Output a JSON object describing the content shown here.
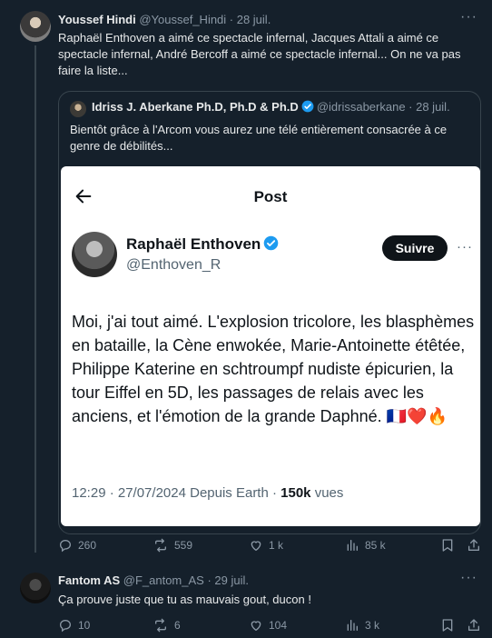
{
  "tweet1": {
    "author": "Youssef Hindi",
    "meta": "@Youssef_Hindi · 28 juil.",
    "text": "Raphaël Enthoven a aimé ce spectacle infernal, Jacques Attali a aimé ce spectacle infernal, André Bercoff a aimé ce spectacle infernal... On ne va pas faire la liste...",
    "quote": {
      "author": "Idriss J. Aberkane Ph.D, Ph.D & Ph.D",
      "meta": "@idrissaberkane · 28 juil.",
      "text": "Bientôt grâce à l'Arcom vous aurez une télé entièrement consacrée à ce genre de débilités...",
      "card": {
        "title": "Post",
        "name": "Raphaël Enthoven",
        "handle": "@Enthoven_R",
        "follow_label": "Suivre",
        "text": "Moi, j'ai tout aimé. L'explosion tricolore, les blasphèmes en bataille, la Cène enwokée, Marie-Antoinette étêtée, Philippe Katerine en schtroumpf nudiste épicurien, la tour Eiffel en 5D, les passages de relais avec les anciens, et l'émotion de la grande Daphné. 🇫🇷❤️🔥",
        "timestamp": "12:29 · 27/07/2024 Depuis Earth · ",
        "views_count": "150k",
        "views_label": " vues"
      }
    },
    "actions": {
      "replies": "260",
      "reposts": "559",
      "likes": "1 k",
      "views": "85 k"
    }
  },
  "tweet2": {
    "author": "Fantom AS",
    "meta": "@F_antom_AS · 29 juil.",
    "text": "Ça prouve juste que tu as mauvais gout, ducon !",
    "actions": {
      "replies": "10",
      "reposts": "6",
      "likes": "104",
      "views": "3 k"
    }
  },
  "colors": {
    "background": "#15202b",
    "verified": "#1d9bf0",
    "text": "#e7e9ea",
    "muted": "#8b98a5"
  }
}
